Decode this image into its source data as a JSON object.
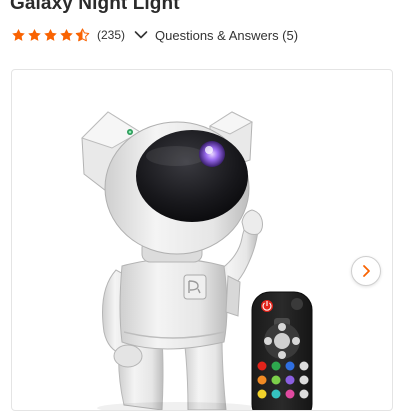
{
  "product": {
    "title": "Galaxy Night Light",
    "rating": 4.5,
    "rating_max": 5,
    "review_count": "(235)",
    "qa_link": "Questions & Answers (5)"
  },
  "icons": {
    "rating": "star-icon",
    "expand": "chevron-down-icon",
    "next": "chevron-right-icon"
  },
  "colors": {
    "star": "#f96302",
    "remote_power": "#e2231a"
  }
}
